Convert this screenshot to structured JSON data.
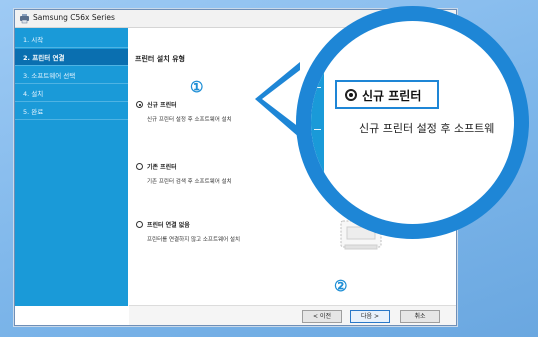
{
  "window": {
    "title": "Samsung C56x Series"
  },
  "sidebar": {
    "items": [
      {
        "label": "1. 시작"
      },
      {
        "label": "2. 프린터 연결"
      },
      {
        "label": "3. 소프트웨어 선택"
      },
      {
        "label": "4. 설치"
      },
      {
        "label": "5. 완료"
      }
    ],
    "active_index": 1
  },
  "main": {
    "heading": "프린터 설치 유형",
    "options": [
      {
        "label": "신규 프린터",
        "description": "신규 프린터 설정 후 소프트웨어 설치",
        "selected": true
      },
      {
        "label": "기존 프린터",
        "description": "기존 프린터 검색 후 소프트웨어 설치",
        "selected": false
      },
      {
        "label": "프린터 연결 없음",
        "description": "프린터를 연결하지 않고 소프트웨어 설치",
        "selected": false
      }
    ]
  },
  "buttons": {
    "back": "< 이전",
    "next": "다음 >",
    "cancel": "취소"
  },
  "markers": {
    "one": "①",
    "two": "②"
  },
  "zoom": {
    "label": "신규 프린터",
    "description": "신규 프린터 설정 후 소프트웨"
  },
  "colors": {
    "accent": "#1a9ad8",
    "sidebar_active": "#0a6fb0",
    "callout": "#1e86d6",
    "marker": "#1f8fd6"
  }
}
